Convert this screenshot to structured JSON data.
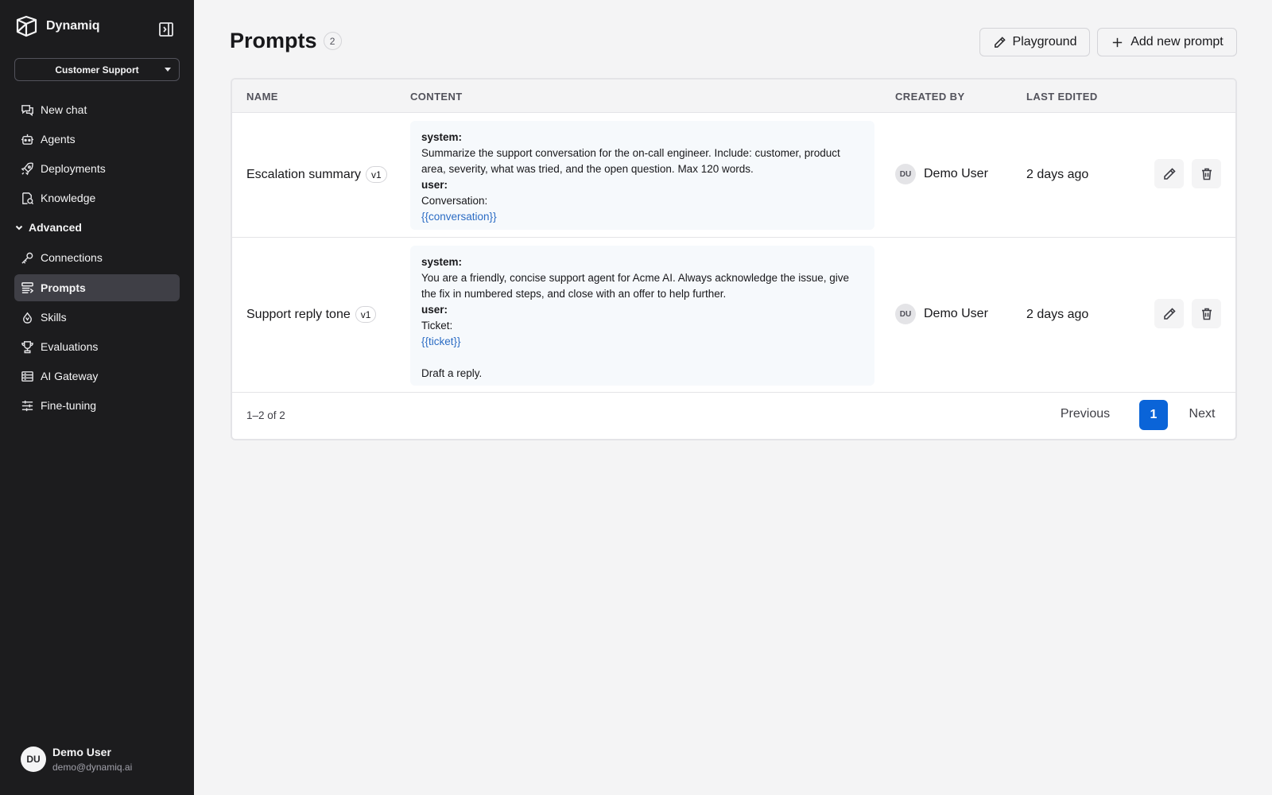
{
  "app": {
    "name": "Dynamiq"
  },
  "workspace": {
    "selected": "Customer Support"
  },
  "sidebar": {
    "items": [
      {
        "label": "New chat",
        "icon": "chat-icon"
      },
      {
        "label": "Agents",
        "icon": "robot-icon"
      },
      {
        "label": "Deployments",
        "icon": "rocket-icon"
      },
      {
        "label": "Knowledge",
        "icon": "knowledge-icon"
      }
    ],
    "section_label": "Advanced",
    "advanced_items": [
      {
        "label": "Connections",
        "icon": "key-icon"
      },
      {
        "label": "Prompts",
        "icon": "prompts-icon",
        "active": true
      },
      {
        "label": "Skills",
        "icon": "skills-icon"
      },
      {
        "label": "Evaluations",
        "icon": "trophy-icon"
      },
      {
        "label": "AI Gateway",
        "icon": "gateway-icon"
      },
      {
        "label": "Fine-tuning",
        "icon": "sliders-icon"
      }
    ]
  },
  "user": {
    "initials": "DU",
    "name": "Demo User",
    "email": "demo@dynamiq.ai"
  },
  "page": {
    "title": "Prompts",
    "count": "2",
    "playground_label": "Playground",
    "add_label": "Add new prompt"
  },
  "table": {
    "headers": {
      "name": "NAME",
      "content": "CONTENT",
      "created_by": "CREATED BY",
      "last_edited": "LAST EDITED"
    },
    "rows": [
      {
        "name": "Escalation summary",
        "version": "v1",
        "content": {
          "system_role": "system:",
          "system_text": "Summarize the support conversation for the on-call engineer. Include: customer, product area, severity, what was tried, and the open question. Max 120 words.",
          "user_role": "user:",
          "user_lines": [
            "Conversation:"
          ],
          "variable": "{{conversation}}",
          "after": ""
        },
        "creator_initials": "DU",
        "creator": "Demo User",
        "edited": "2 days ago"
      },
      {
        "name": "Support reply tone",
        "version": "v1",
        "content": {
          "system_role": "system:",
          "system_text": "You are a friendly, concise support agent for Acme AI. Always acknowledge the issue, give the fix in numbered steps, and close with an offer to help further.",
          "user_role": "user:",
          "user_lines": [
            "Ticket:"
          ],
          "variable": "{{ticket}}",
          "after": "Draft a reply."
        },
        "creator_initials": "DU",
        "creator": "Demo User",
        "edited": "2 days ago"
      }
    ]
  },
  "pagination": {
    "range": "1–2 of 2",
    "prev": "Previous",
    "current": "1",
    "next": "Next"
  },
  "colors": {
    "sidebar_bg": "#1c1c1e",
    "accent": "#0a64d8",
    "variable": "#2b6cc4"
  }
}
